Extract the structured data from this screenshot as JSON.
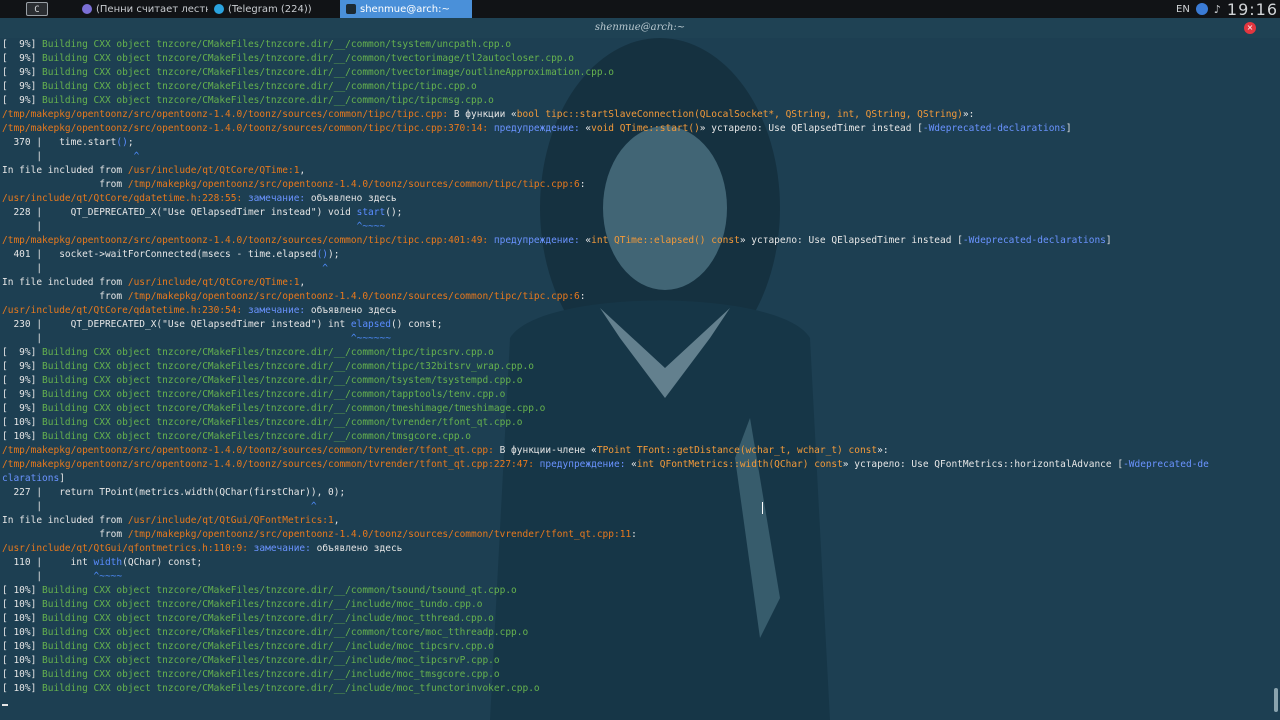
{
  "panel": {
    "launcher_label": "C",
    "tasks": [
      {
        "label": "(Пенни считает лестнич...",
        "icon": "browser-icon",
        "active": false
      },
      {
        "label": "(Telegram (224))",
        "icon": "telegram-icon",
        "active": false
      },
      {
        "label": "shenmue@arch:~",
        "icon": "terminal-icon",
        "active": true
      }
    ],
    "lang": "EN",
    "clock": "19:16"
  },
  "window": {
    "title": "shenmue@arch:~",
    "close_label": "×"
  },
  "terminal_lines": [
    [
      [
        "[  9%] ",
        "c-pct"
      ],
      [
        "Building CXX object tnzcore/CMakeFiles/tnzcore.dir/__/common/tsystem/uncpath.cpp.o",
        "c-build"
      ]
    ],
    [
      [
        "[  9%] ",
        "c-pct"
      ],
      [
        "Building CXX object tnzcore/CMakeFiles/tnzcore.dir/__/common/tvectorimage/tl2autocloser.cpp.o",
        "c-build"
      ]
    ],
    [
      [
        "[  9%] ",
        "c-pct"
      ],
      [
        "Building CXX object tnzcore/CMakeFiles/tnzcore.dir/__/common/tvectorimage/outlineApproximation.cpp.o",
        "c-build"
      ]
    ],
    [
      [
        "[  9%] ",
        "c-pct"
      ],
      [
        "Building CXX object tnzcore/CMakeFiles/tnzcore.dir/__/common/tipc/tipc.cpp.o",
        "c-build"
      ]
    ],
    [
      [
        "[  9%] ",
        "c-pct"
      ],
      [
        "Building CXX object tnzcore/CMakeFiles/tnzcore.dir/__/common/tipc/tipcmsg.cpp.o",
        "c-build"
      ]
    ],
    [
      [
        "/tmp/makepkg/opentoonz/src/opentoonz-1.4.0/toonz/sources/common/tipc/tipc.cpp:",
        "c-path"
      ],
      [
        " В функции «",
        "c-white"
      ],
      [
        "bool tipc::startSlaveConnection(QLocalSocket*, QString, int, QString, QString)",
        "c-quote"
      ],
      [
        "»:",
        "c-white"
      ]
    ],
    [
      [
        "/tmp/makepkg/opentoonz/src/opentoonz-1.4.0/toonz/sources/common/tipc/tipc.cpp:370:14:",
        "c-path"
      ],
      [
        " предупреждение: ",
        "c-warn"
      ],
      [
        "«",
        "c-white"
      ],
      [
        "void QTime::start()",
        "c-quote"
      ],
      [
        "» устарело: Use QElapsedTimer instead [",
        "c-white"
      ],
      [
        "-Wdeprecated-declarations",
        "c-flag"
      ],
      [
        "]",
        "c-white"
      ]
    ],
    [
      [
        "  370 |   time.start",
        "c-white"
      ],
      [
        "()",
        "c-blue"
      ],
      [
        ";",
        "c-white"
      ]
    ],
    [
      [
        "      |                ",
        "c-white"
      ],
      [
        "^",
        "c-caret"
      ]
    ],
    [
      [
        "In file included from ",
        "c-white"
      ],
      [
        "/usr/include/qt/QtCore/QTime:1",
        "c-path"
      ],
      [
        ",",
        "c-white"
      ]
    ],
    [
      [
        "                 from ",
        "c-white"
      ],
      [
        "/tmp/makepkg/opentoonz/src/opentoonz-1.4.0/toonz/sources/common/tipc/tipc.cpp:6",
        "c-path"
      ],
      [
        ":",
        "c-white"
      ]
    ],
    [
      [
        "/usr/include/qt/QtCore/qdatetime.h:228:55:",
        "c-path"
      ],
      [
        " замечание: ",
        "c-warn"
      ],
      [
        "объявлено здесь",
        "c-white"
      ]
    ],
    [
      [
        "  228 |     QT_DEPRECATED_X(\"Use QElapsedTimer instead\") void ",
        "c-white"
      ],
      [
        "start",
        "c-blue"
      ],
      [
        "();",
        "c-white"
      ]
    ],
    [
      [
        "      |                                                       ",
        "c-white"
      ],
      [
        "^~~~~",
        "c-caret"
      ]
    ],
    [
      [
        "/tmp/makepkg/opentoonz/src/opentoonz-1.4.0/toonz/sources/common/tipc/tipc.cpp:401:49:",
        "c-path"
      ],
      [
        " предупреждение: ",
        "c-warn"
      ],
      [
        "«",
        "c-white"
      ],
      [
        "int QTime::elapsed() const",
        "c-quote"
      ],
      [
        "» устарело: Use QElapsedTimer instead [",
        "c-white"
      ],
      [
        "-Wdeprecated-declarations",
        "c-flag"
      ],
      [
        "]",
        "c-white"
      ]
    ],
    [
      [
        "  401 |   socket->waitForConnected(msecs - time.elapsed",
        "c-white"
      ],
      [
        "()",
        "c-blue"
      ],
      [
        ");",
        "c-white"
      ]
    ],
    [
      [
        "      |                                                 ",
        "c-white"
      ],
      [
        "^",
        "c-caret"
      ]
    ],
    [
      [
        "In file included from ",
        "c-white"
      ],
      [
        "/usr/include/qt/QtCore/QTime:1",
        "c-path"
      ],
      [
        ",",
        "c-white"
      ]
    ],
    [
      [
        "                 from ",
        "c-white"
      ],
      [
        "/tmp/makepkg/opentoonz/src/opentoonz-1.4.0/toonz/sources/common/tipc/tipc.cpp:6",
        "c-path"
      ],
      [
        ":",
        "c-white"
      ]
    ],
    [
      [
        "/usr/include/qt/QtCore/qdatetime.h:230:54:",
        "c-path"
      ],
      [
        " замечание: ",
        "c-warn"
      ],
      [
        "объявлено здесь",
        "c-white"
      ]
    ],
    [
      [
        "  230 |     QT_DEPRECATED_X(\"Use QElapsedTimer instead\") int ",
        "c-white"
      ],
      [
        "elapsed",
        "c-blue"
      ],
      [
        "() const;",
        "c-white"
      ]
    ],
    [
      [
        "      |                                                      ",
        "c-white"
      ],
      [
        "^~~~~~~",
        "c-caret"
      ]
    ],
    [
      [
        "[  9%] ",
        "c-pct"
      ],
      [
        "Building CXX object tnzcore/CMakeFiles/tnzcore.dir/__/common/tipc/tipcsrv.cpp.o",
        "c-build"
      ]
    ],
    [
      [
        "[  9%] ",
        "c-pct"
      ],
      [
        "Building CXX object tnzcore/CMakeFiles/tnzcore.dir/__/common/tipc/t32bitsrv_wrap.cpp.o",
        "c-build"
      ]
    ],
    [
      [
        "[  9%] ",
        "c-pct"
      ],
      [
        "Building CXX object tnzcore/CMakeFiles/tnzcore.dir/__/common/tsystem/tsystempd.cpp.o",
        "c-build"
      ]
    ],
    [
      [
        "[  9%] ",
        "c-pct"
      ],
      [
        "Building CXX object tnzcore/CMakeFiles/tnzcore.dir/__/common/tapptools/tenv.cpp.o",
        "c-build"
      ]
    ],
    [
      [
        "[  9%] ",
        "c-pct"
      ],
      [
        "Building CXX object tnzcore/CMakeFiles/tnzcore.dir/__/common/tmeshimage/tmeshimage.cpp.o",
        "c-build"
      ]
    ],
    [
      [
        "[ 10%] ",
        "c-pct"
      ],
      [
        "Building CXX object tnzcore/CMakeFiles/tnzcore.dir/__/common/tvrender/tfont_qt.cpp.o",
        "c-build"
      ]
    ],
    [
      [
        "[ 10%] ",
        "c-pct"
      ],
      [
        "Building CXX object tnzcore/CMakeFiles/tnzcore.dir/__/common/tmsgcore.cpp.o",
        "c-build"
      ]
    ],
    [
      [
        "/tmp/makepkg/opentoonz/src/opentoonz-1.4.0/toonz/sources/common/tvrender/tfont_qt.cpp:",
        "c-path"
      ],
      [
        " В функции-члене «",
        "c-white"
      ],
      [
        "TPoint TFont::getDistance(wchar_t, wchar_t) const",
        "c-quote"
      ],
      [
        "»:",
        "c-white"
      ]
    ],
    [
      [
        "/tmp/makepkg/opentoonz/src/opentoonz-1.4.0/toonz/sources/common/tvrender/tfont_qt.cpp:227:47:",
        "c-path"
      ],
      [
        " предупреждение: ",
        "c-warn"
      ],
      [
        "«",
        "c-white"
      ],
      [
        "int QFontMetrics::width(QChar) const",
        "c-quote"
      ],
      [
        "» устарело: Use QFontMetrics::horizontalAdvance [",
        "c-white"
      ],
      [
        "-Wdeprecated-de",
        "c-flag"
      ]
    ],
    [
      [
        "clarations",
        "c-flag"
      ],
      [
        "]",
        "c-white"
      ]
    ],
    [
      [
        "  227 |   return TPoint(metrics.width(QChar(firstChar)), 0);",
        "c-white"
      ]
    ],
    [
      [
        "      |                                               ",
        "c-white"
      ],
      [
        "^",
        "c-caret"
      ]
    ],
    [
      [
        "In file included from ",
        "c-white"
      ],
      [
        "/usr/include/qt/QtGui/QFontMetrics:1",
        "c-path"
      ],
      [
        ",",
        "c-white"
      ]
    ],
    [
      [
        "                 from ",
        "c-white"
      ],
      [
        "/tmp/makepkg/opentoonz/src/opentoonz-1.4.0/toonz/sources/common/tvrender/tfont_qt.cpp:11",
        "c-path"
      ],
      [
        ":",
        "c-white"
      ]
    ],
    [
      [
        "/usr/include/qt/QtGui/qfontmetrics.h:110:9:",
        "c-path"
      ],
      [
        " замечание: ",
        "c-warn"
      ],
      [
        "объявлено здесь",
        "c-white"
      ]
    ],
    [
      [
        "  110 |     int ",
        "c-white"
      ],
      [
        "width",
        "c-blue"
      ],
      [
        "(QChar) const;",
        "c-white"
      ]
    ],
    [
      [
        "      |         ",
        "c-white"
      ],
      [
        "^~~~~",
        "c-caret"
      ]
    ],
    [
      [
        "[ 10%] ",
        "c-pct"
      ],
      [
        "Building CXX object tnzcore/CMakeFiles/tnzcore.dir/__/common/tsound/tsound_qt.cpp.o",
        "c-build"
      ]
    ],
    [
      [
        "[ 10%] ",
        "c-pct"
      ],
      [
        "Building CXX object tnzcore/CMakeFiles/tnzcore.dir/__/include/moc_tundo.cpp.o",
        "c-build"
      ]
    ],
    [
      [
        "[ 10%] ",
        "c-pct"
      ],
      [
        "Building CXX object tnzcore/CMakeFiles/tnzcore.dir/__/include/moc_tthread.cpp.o",
        "c-build"
      ]
    ],
    [
      [
        "[ 10%] ",
        "c-pct"
      ],
      [
        "Building CXX object tnzcore/CMakeFiles/tnzcore.dir/__/common/tcore/moc_tthreadp.cpp.o",
        "c-build"
      ]
    ],
    [
      [
        "[ 10%] ",
        "c-pct"
      ],
      [
        "Building CXX object tnzcore/CMakeFiles/tnzcore.dir/__/include/moc_tipcsrv.cpp.o",
        "c-build"
      ]
    ],
    [
      [
        "[ 10%] ",
        "c-pct"
      ],
      [
        "Building CXX object tnzcore/CMakeFiles/tnzcore.dir/__/include/moc_tipcsrvP.cpp.o",
        "c-build"
      ]
    ],
    [
      [
        "[ 10%] ",
        "c-pct"
      ],
      [
        "Building CXX object tnzcore/CMakeFiles/tnzcore.dir/__/include/moc_tmsgcore.cpp.o",
        "c-build"
      ]
    ],
    [
      [
        "[ 10%] ",
        "c-pct"
      ],
      [
        "Building CXX object tnzcore/CMakeFiles/tnzcore.dir/__/include/moc_tfunctorinvoker.cpp.o",
        "c-build"
      ]
    ]
  ]
}
